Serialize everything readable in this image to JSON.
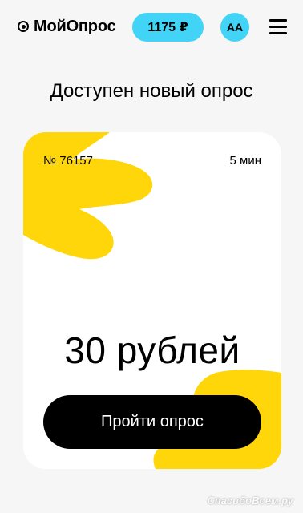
{
  "header": {
    "logo_text": "МойОпрос",
    "balance": "1175 ₽",
    "avatar_initials": "AA"
  },
  "main": {
    "title": "Доступен новый опрос"
  },
  "card": {
    "survey_number": "№ 76157",
    "duration": "5 мин",
    "reward": "30 рублей",
    "cta_label": "Пройти опрос"
  },
  "watermark": "СпасибоВсем.ру",
  "colors": {
    "accent": "#42d4f6",
    "yellow": "#ffd60a",
    "background": "#f6f6f6"
  }
}
